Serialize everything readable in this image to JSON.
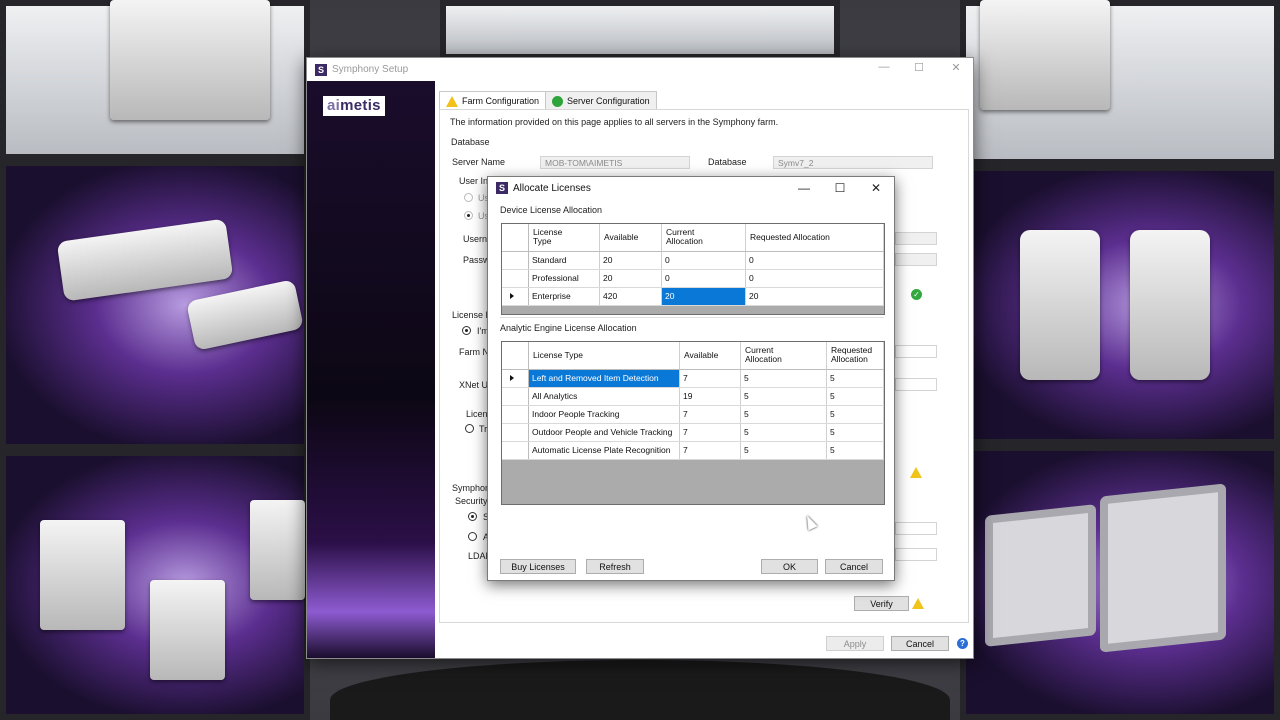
{
  "setup_window": {
    "title": "Symphony Setup",
    "app_icon_letter": "S",
    "brand_logo": {
      "part1": "ai",
      "part2": "metis"
    },
    "tabs": [
      {
        "label": "Farm Configuration",
        "icon": "warning-icon"
      },
      {
        "label": "Server Configuration",
        "icon": "checkmark-icon"
      }
    ],
    "info_text": "The information provided on this page applies to all servers in the Symphony farm.",
    "database_group": "Database",
    "server_name_label": "Server Name",
    "server_name_value": "MOB-TOM\\AIMETIS",
    "database_label": "Database",
    "database_value": "Symv7_2",
    "user_info_label": "User Inf",
    "user_opt_1": "Us",
    "user_opt_2": "Us",
    "username_label": "Userna",
    "password_label": "Passw",
    "license_group": "License F",
    "license_radio": "I'm",
    "farm_name_label": "Farm Na",
    "xnet_label": "XNet Us",
    "license_label_2": "Licens",
    "trial_label": "Tri",
    "symphony_group": "Symphon",
    "security_label": "Security",
    "security_opt_1": "S",
    "security_opt_2": "A",
    "ldap_label": "LDAP",
    "verify_button": "Verify",
    "apply_button": "Apply",
    "cancel_button": "Cancel",
    "help_icon": "?"
  },
  "dialog": {
    "title": "Allocate Licenses",
    "icon_letter": "S",
    "device_group": "Device License Allocation",
    "device_headers": [
      "License\nType",
      "Available",
      "Current\nAllocation",
      "Requested Allocation"
    ],
    "device_rows": [
      {
        "type": "Standard",
        "available": "20",
        "current": "0",
        "requested": "0"
      },
      {
        "type": "Professional",
        "available": "20",
        "current": "0",
        "requested": "0"
      },
      {
        "type": "Enterprise",
        "available": "420",
        "current": "20",
        "requested": "20"
      }
    ],
    "analytic_group": "Analytic Engine License Allocation",
    "analytic_headers": [
      "License Type",
      "Available",
      "Current\nAllocation",
      "Requested\nAllocation"
    ],
    "analytic_rows": [
      {
        "type": "Left and Removed Item Detection",
        "available": "7",
        "current": "5",
        "requested": "5"
      },
      {
        "type": "All Analytics",
        "available": "19",
        "current": "5",
        "requested": "5"
      },
      {
        "type": "Indoor People Tracking",
        "available": "7",
        "current": "5",
        "requested": "5"
      },
      {
        "type": "Outdoor People and Vehicle Tracking",
        "available": "7",
        "current": "5",
        "requested": "5"
      },
      {
        "type": "Automatic License Plate Recognition",
        "available": "7",
        "current": "5",
        "requested": "5"
      }
    ],
    "buy_button": "Buy Licenses",
    "refresh_button": "Refresh",
    "ok_button": "OK",
    "cancel_button": "Cancel"
  },
  "colors": {
    "selection": "#0a78d7",
    "brand_purple": "#3c2a66",
    "warning": "#f2c11c",
    "ok": "#2ea43a"
  }
}
